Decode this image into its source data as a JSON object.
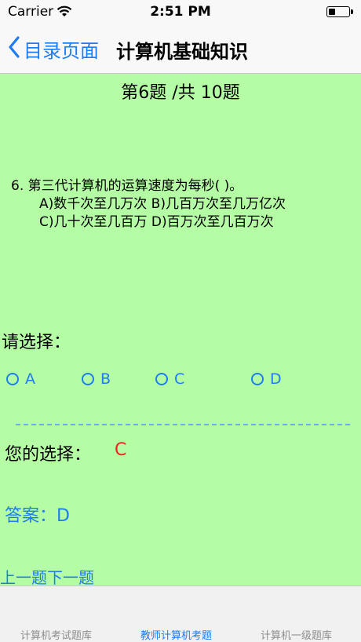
{
  "status_bar": {
    "carrier": "Carrier",
    "time": "2:51 PM",
    "battery_level": 0.35
  },
  "nav": {
    "back_label": "目录页面",
    "title": "计算机基础知识"
  },
  "counter": "第6题 /共 10题",
  "question": {
    "stem": "6. 第三代计算机的运算速度为每秒( )。",
    "line2": "A)数千次至几万次 B)几百万次至几万亿次",
    "line3": "C)几十次至几百万 D)百万次至几百万次"
  },
  "select_prompt": "请选择：",
  "options": [
    {
      "label": "A"
    },
    {
      "label": "B"
    },
    {
      "label": "C"
    },
    {
      "label": "D"
    }
  ],
  "your_choice": {
    "label": "您的选择：",
    "value": "C"
  },
  "answer": "答案：D",
  "prev_label": "上一题",
  "next_label": "下一题",
  "tabs": [
    {
      "label": "计算机考试题库"
    },
    {
      "label": "教师计算机考题"
    },
    {
      "label": "计算机一级题库"
    }
  ],
  "colors": {
    "background": "#b5fda4",
    "accent": "#1e7cf3",
    "selected": "#ee2222"
  }
}
